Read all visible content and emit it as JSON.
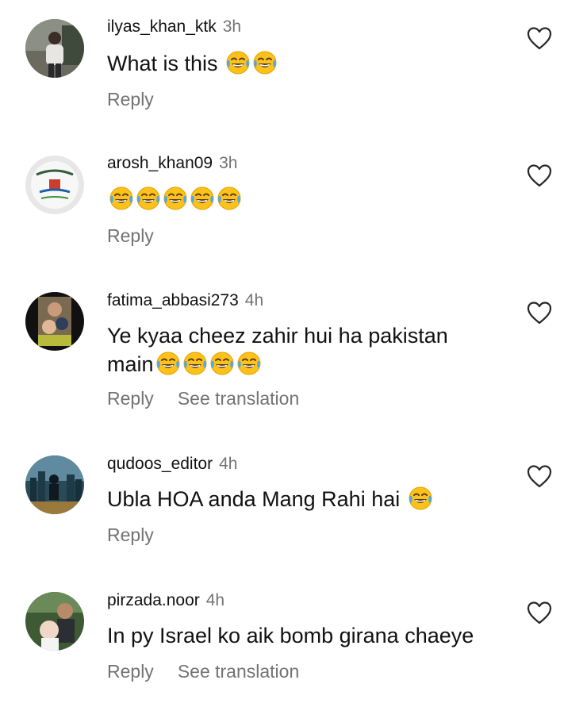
{
  "comments": [
    {
      "username": "ilyas_khan_ktk",
      "time": "3h",
      "text": "What is this",
      "emoji_count": 2,
      "actions": {
        "reply": "Reply"
      }
    },
    {
      "username": "arosh_khan09",
      "time": "3h",
      "text": "",
      "emoji_count": 5,
      "actions": {
        "reply": "Reply"
      }
    },
    {
      "username": "fatima_abbasi273",
      "time": "4h",
      "text_line1": "Ye kyaa cheez zahir hui ha pakistan",
      "text_line2": "main",
      "emoji_count": 4,
      "actions": {
        "reply": "Reply",
        "translate": "See translation"
      }
    },
    {
      "username": "qudoos_editor",
      "time": "4h",
      "text": "Ubla HOA anda Mang Rahi hai",
      "emoji_count": 1,
      "actions": {
        "reply": "Reply"
      }
    },
    {
      "username": "pirzada.noor",
      "time": "4h",
      "text": "In py Israel ko aik bomb girana chaeye",
      "emoji_count": 0,
      "actions": {
        "reply": "Reply",
        "translate": "See translation"
      }
    }
  ],
  "icons": {
    "like": "heart-outline-icon",
    "reaction": "face-with-tears-of-joy-emoji"
  },
  "colors": {
    "text": "#111111",
    "secondary": "#737373",
    "background": "#ffffff"
  }
}
